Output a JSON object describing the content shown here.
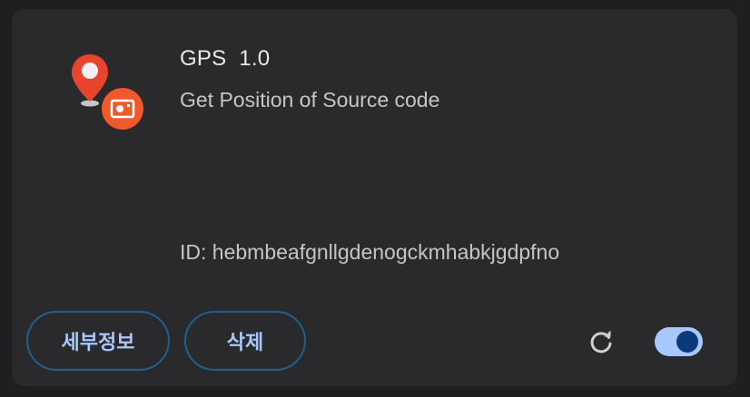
{
  "extension": {
    "name": "GPS",
    "version": "1.0",
    "description": "Get Position of Source code",
    "id_text": "ID: hebmbeafgnllgdenogckmhabkjgdpfno",
    "icon": "map-pin-with-camera-icon",
    "enabled": true
  },
  "actions": {
    "details_label": "세부정보",
    "remove_label": "삭제",
    "reload_icon": "reload-icon"
  },
  "colors": {
    "card_bg": "#2a2a2d",
    "accent": "#a8c7fa",
    "button_border": "#1f5f8f",
    "pin_red": "#e8442e",
    "badge_orange": "#f05a2a",
    "toggle_knob": "#0b3a7a"
  }
}
